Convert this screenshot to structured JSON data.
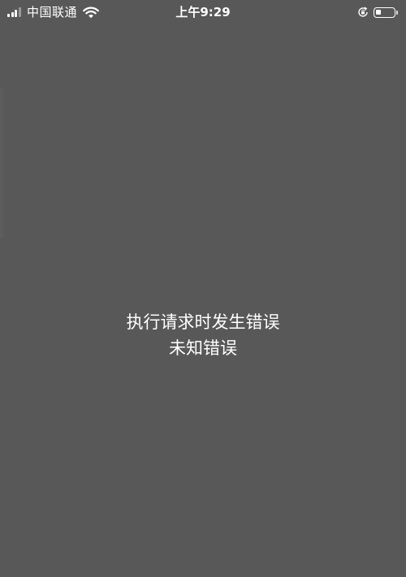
{
  "status_bar": {
    "carrier": "中国联通",
    "time": "上午9:29",
    "signal_icon": "signal-bars-icon",
    "wifi_icon": "wifi-icon",
    "orientation_lock_icon": "orientation-lock-icon",
    "battery_icon": "battery-icon",
    "signal_bars_active": 3,
    "signal_bars_total": 4,
    "battery_level": 0.3
  },
  "error": {
    "title": "执行请求时发生错误",
    "detail": "未知错误"
  },
  "colors": {
    "background": "#585858",
    "text": "#ffffff"
  }
}
